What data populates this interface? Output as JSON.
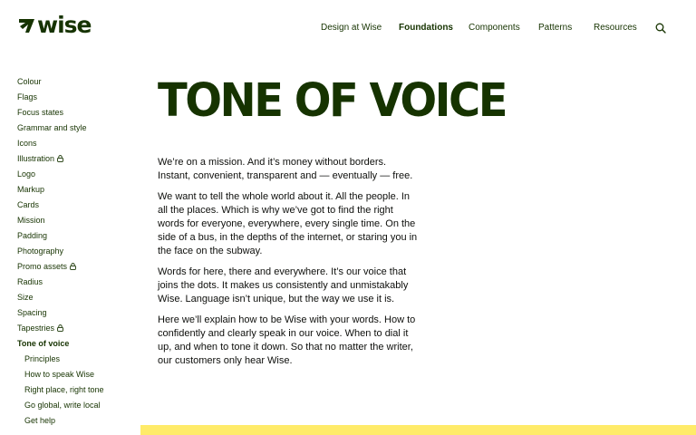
{
  "header": {
    "logo_text": "wise",
    "nav": [
      {
        "label": "Design at Wise",
        "active": false
      },
      {
        "label": "Foundations",
        "active": true
      },
      {
        "label": "Components",
        "active": false
      },
      {
        "label": "Patterns",
        "active": false
      },
      {
        "label": "Resources",
        "active": false
      }
    ],
    "search_icon": "search-icon"
  },
  "sidebar": {
    "items": [
      {
        "label": "Colour"
      },
      {
        "label": "Flags"
      },
      {
        "label": "Focus states"
      },
      {
        "label": "Grammar and style"
      },
      {
        "label": "Icons"
      },
      {
        "label": "Illustration",
        "locked": true
      },
      {
        "label": "Logo"
      },
      {
        "label": "Markup"
      },
      {
        "label": "Cards"
      },
      {
        "label": "Mission"
      },
      {
        "label": "Padding"
      },
      {
        "label": "Photography"
      },
      {
        "label": "Promo assets",
        "locked": true
      },
      {
        "label": "Radius"
      },
      {
        "label": "Size"
      },
      {
        "label": "Spacing"
      },
      {
        "label": "Tapestries",
        "locked": true
      },
      {
        "label": "Tone of voice",
        "active": true
      }
    ],
    "subitems": [
      {
        "label": "Principles"
      },
      {
        "label": "How to speak Wise"
      },
      {
        "label": "Right place, right tone"
      },
      {
        "label": "Go global, write local"
      },
      {
        "label": "Get help"
      }
    ]
  },
  "main": {
    "title": "TONE OF VOICE",
    "paragraphs": [
      "We’re on a mission. And it’s money without borders. Instant, convenient, transparent and — eventually — free.",
      "We want to tell the whole world about it. All the people. In all the places. Which is why we’ve got to find the right words for everyone, everywhere, every single time. On the side of a bus, in the depths of the internet, or staring you in the face on the subway.",
      "Words for here, there and everywhere. It’s our voice that joins the dots. It makes us consistently and unmistakably Wise. Language isn’t unique, but the way we use it is.",
      "Here we’ll explain how to be Wise with your words. How to confidently and clearly speak in our voice. When to dial it up, and when to tone it down. So that no matter the writer, our customers only hear Wise."
    ]
  },
  "colors": {
    "brand_green": "#163300",
    "body_text": "#0e0f0c",
    "accent_yellow": "#ffeb69",
    "background": "#ffffff"
  }
}
